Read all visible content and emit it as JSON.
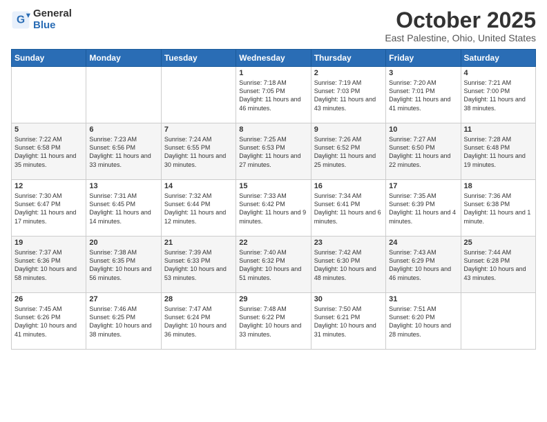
{
  "header": {
    "logo_general": "General",
    "logo_blue": "Blue",
    "title": "October 2025",
    "location": "East Palestine, Ohio, United States"
  },
  "days_of_week": [
    "Sunday",
    "Monday",
    "Tuesday",
    "Wednesday",
    "Thursday",
    "Friday",
    "Saturday"
  ],
  "weeks": [
    [
      {
        "day": "",
        "content": ""
      },
      {
        "day": "",
        "content": ""
      },
      {
        "day": "",
        "content": ""
      },
      {
        "day": "1",
        "content": "Sunrise: 7:18 AM\nSunset: 7:05 PM\nDaylight: 11 hours and 46 minutes."
      },
      {
        "day": "2",
        "content": "Sunrise: 7:19 AM\nSunset: 7:03 PM\nDaylight: 11 hours and 43 minutes."
      },
      {
        "day": "3",
        "content": "Sunrise: 7:20 AM\nSunset: 7:01 PM\nDaylight: 11 hours and 41 minutes."
      },
      {
        "day": "4",
        "content": "Sunrise: 7:21 AM\nSunset: 7:00 PM\nDaylight: 11 hours and 38 minutes."
      }
    ],
    [
      {
        "day": "5",
        "content": "Sunrise: 7:22 AM\nSunset: 6:58 PM\nDaylight: 11 hours and 35 minutes."
      },
      {
        "day": "6",
        "content": "Sunrise: 7:23 AM\nSunset: 6:56 PM\nDaylight: 11 hours and 33 minutes."
      },
      {
        "day": "7",
        "content": "Sunrise: 7:24 AM\nSunset: 6:55 PM\nDaylight: 11 hours and 30 minutes."
      },
      {
        "day": "8",
        "content": "Sunrise: 7:25 AM\nSunset: 6:53 PM\nDaylight: 11 hours and 27 minutes."
      },
      {
        "day": "9",
        "content": "Sunrise: 7:26 AM\nSunset: 6:52 PM\nDaylight: 11 hours and 25 minutes."
      },
      {
        "day": "10",
        "content": "Sunrise: 7:27 AM\nSunset: 6:50 PM\nDaylight: 11 hours and 22 minutes."
      },
      {
        "day": "11",
        "content": "Sunrise: 7:28 AM\nSunset: 6:48 PM\nDaylight: 11 hours and 19 minutes."
      }
    ],
    [
      {
        "day": "12",
        "content": "Sunrise: 7:30 AM\nSunset: 6:47 PM\nDaylight: 11 hours and 17 minutes."
      },
      {
        "day": "13",
        "content": "Sunrise: 7:31 AM\nSunset: 6:45 PM\nDaylight: 11 hours and 14 minutes."
      },
      {
        "day": "14",
        "content": "Sunrise: 7:32 AM\nSunset: 6:44 PM\nDaylight: 11 hours and 12 minutes."
      },
      {
        "day": "15",
        "content": "Sunrise: 7:33 AM\nSunset: 6:42 PM\nDaylight: 11 hours and 9 minutes."
      },
      {
        "day": "16",
        "content": "Sunrise: 7:34 AM\nSunset: 6:41 PM\nDaylight: 11 hours and 6 minutes."
      },
      {
        "day": "17",
        "content": "Sunrise: 7:35 AM\nSunset: 6:39 PM\nDaylight: 11 hours and 4 minutes."
      },
      {
        "day": "18",
        "content": "Sunrise: 7:36 AM\nSunset: 6:38 PM\nDaylight: 11 hours and 1 minute."
      }
    ],
    [
      {
        "day": "19",
        "content": "Sunrise: 7:37 AM\nSunset: 6:36 PM\nDaylight: 10 hours and 58 minutes."
      },
      {
        "day": "20",
        "content": "Sunrise: 7:38 AM\nSunset: 6:35 PM\nDaylight: 10 hours and 56 minutes."
      },
      {
        "day": "21",
        "content": "Sunrise: 7:39 AM\nSunset: 6:33 PM\nDaylight: 10 hours and 53 minutes."
      },
      {
        "day": "22",
        "content": "Sunrise: 7:40 AM\nSunset: 6:32 PM\nDaylight: 10 hours and 51 minutes."
      },
      {
        "day": "23",
        "content": "Sunrise: 7:42 AM\nSunset: 6:30 PM\nDaylight: 10 hours and 48 minutes."
      },
      {
        "day": "24",
        "content": "Sunrise: 7:43 AM\nSunset: 6:29 PM\nDaylight: 10 hours and 46 minutes."
      },
      {
        "day": "25",
        "content": "Sunrise: 7:44 AM\nSunset: 6:28 PM\nDaylight: 10 hours and 43 minutes."
      }
    ],
    [
      {
        "day": "26",
        "content": "Sunrise: 7:45 AM\nSunset: 6:26 PM\nDaylight: 10 hours and 41 minutes."
      },
      {
        "day": "27",
        "content": "Sunrise: 7:46 AM\nSunset: 6:25 PM\nDaylight: 10 hours and 38 minutes."
      },
      {
        "day": "28",
        "content": "Sunrise: 7:47 AM\nSunset: 6:24 PM\nDaylight: 10 hours and 36 minutes."
      },
      {
        "day": "29",
        "content": "Sunrise: 7:48 AM\nSunset: 6:22 PM\nDaylight: 10 hours and 33 minutes."
      },
      {
        "day": "30",
        "content": "Sunrise: 7:50 AM\nSunset: 6:21 PM\nDaylight: 10 hours and 31 minutes."
      },
      {
        "day": "31",
        "content": "Sunrise: 7:51 AM\nSunset: 6:20 PM\nDaylight: 10 hours and 28 minutes."
      },
      {
        "day": "",
        "content": ""
      }
    ]
  ]
}
